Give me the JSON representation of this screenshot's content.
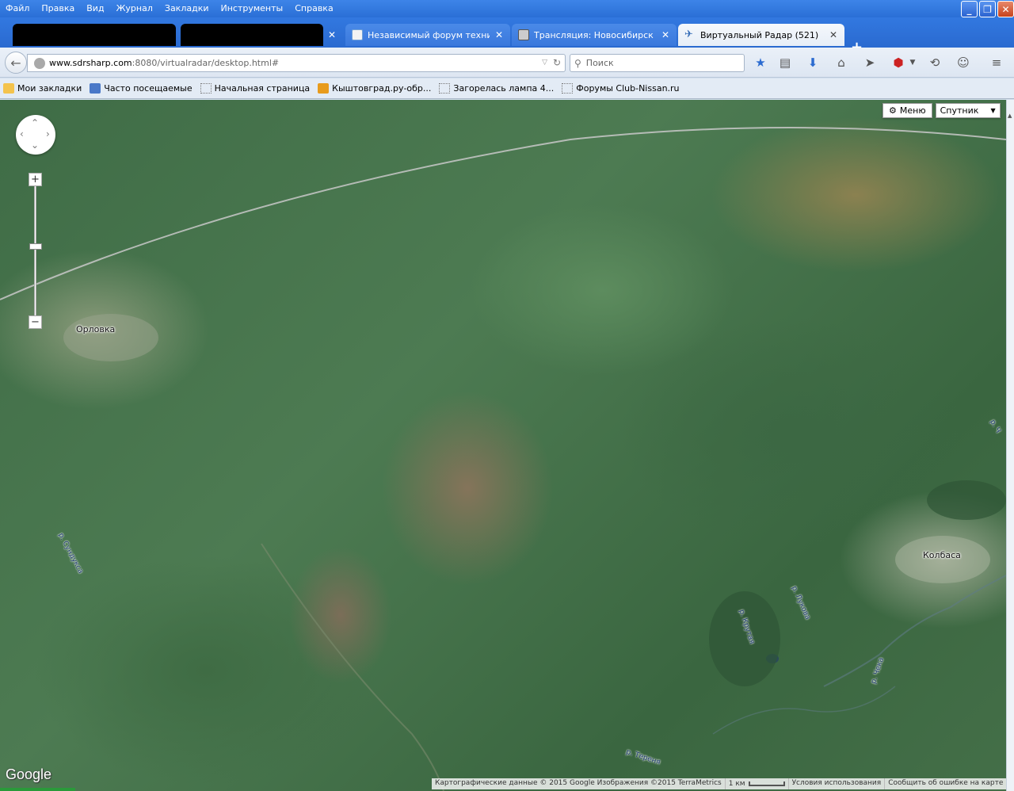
{
  "menu": [
    "Файл",
    "Правка",
    "Вид",
    "Журнал",
    "Закладки",
    "Инструменты",
    "Справка"
  ],
  "window_controls": {
    "minimize": "_",
    "maximize": "❐",
    "close": "✕"
  },
  "tabs": [
    {
      "label": "",
      "redacted": true
    },
    {
      "label": "",
      "redacted": true
    },
    {
      "label": "Независимый форум технич...",
      "icon": "forum-icon"
    },
    {
      "label": "Трансляция: Новосибирск - ...",
      "icon": "broadcast-icon"
    },
    {
      "label": "Виртуальный Радар (521)",
      "icon": "plane-icon",
      "active": true
    }
  ],
  "tab_close": "✕",
  "new_tab": "+",
  "address": {
    "host": "www.sdrsharp.com",
    "path": ":8080/virtualradar/desktop.html#"
  },
  "search": {
    "placeholder": "Поиск"
  },
  "toolbar_icons": [
    "bookmark-star-icon",
    "reading-list-icon",
    "downloads-icon",
    "home-icon",
    "send-icon",
    "adblock-icon",
    "history-icon",
    "emoji-icon",
    "hamburger-menu-icon"
  ],
  "bookmarks": [
    {
      "label": "Мои закладки",
      "icon": "folder"
    },
    {
      "label": "Часто посещаемые",
      "icon": "freq"
    },
    {
      "label": "Начальная страница",
      "icon": "blank"
    },
    {
      "label": "Кыштовград.ру-обр...",
      "icon": "rss"
    },
    {
      "label": "Загорелась лампа 4...",
      "icon": "blank"
    },
    {
      "label": "Форумы Club-Nissan.ru",
      "icon": "blank"
    }
  ],
  "map": {
    "menu_button": "Меню",
    "map_type": "Спутник",
    "zoom_in": "+",
    "zoom_out": "−",
    "logo": "Google",
    "places": {
      "orlovka": "Орловка",
      "kolbasa": "Колбаса"
    },
    "rivers": {
      "sunduk": "р. Сундукса",
      "krutaya": "р. Крутая",
      "lukova": "р. Лукова",
      "cheka": "р. Чека",
      "terenya": "р. Тереня",
      "edge": "р. Ч"
    },
    "attribution": "Картографические данные © 2015 Google Изображения ©2015 TerraMetrics",
    "scale": "1 км",
    "terms": "Условия использования",
    "report": "Сообщить об ошибке на карте"
  },
  "colors": {
    "accent": "#2a6fd6",
    "map_forest": "#3f6c46"
  }
}
